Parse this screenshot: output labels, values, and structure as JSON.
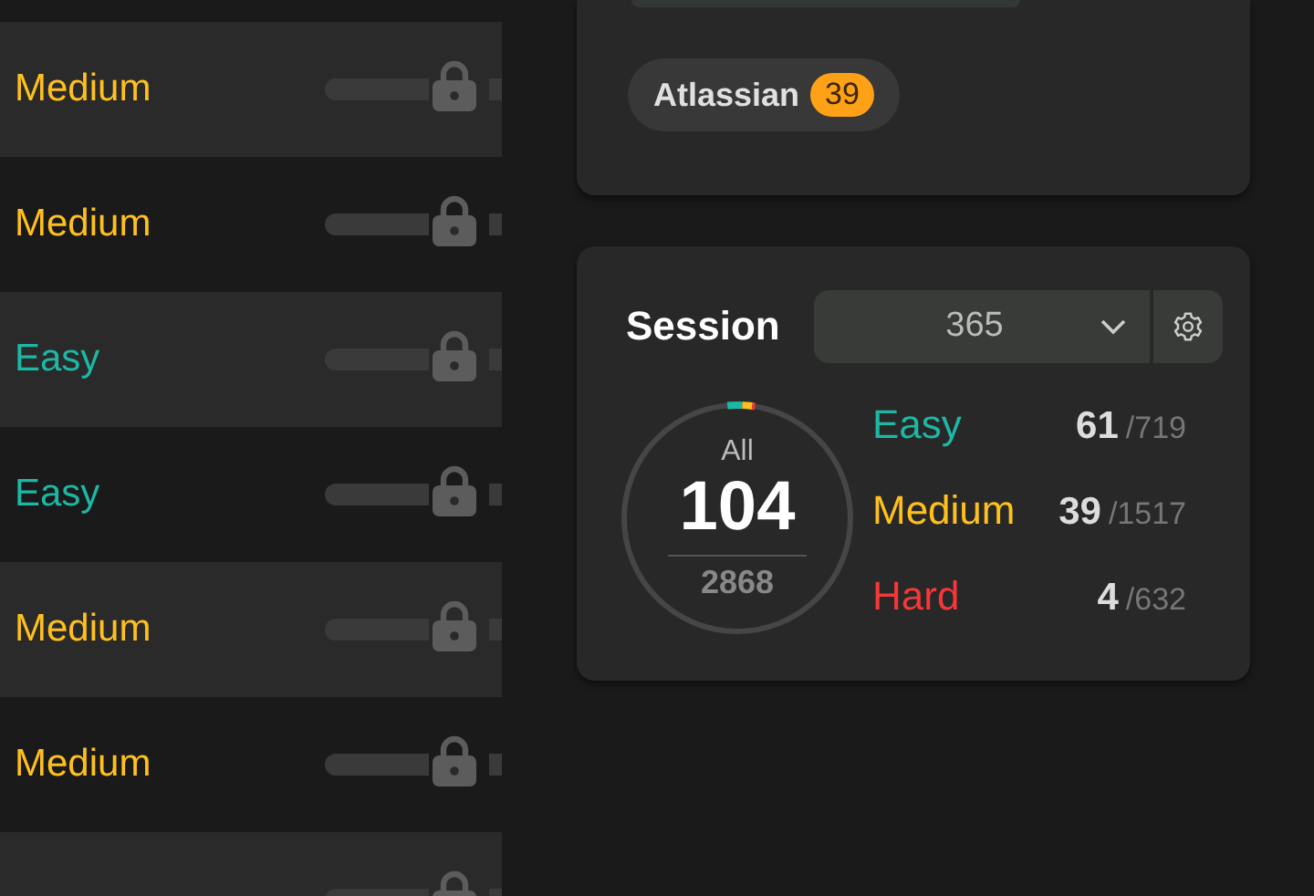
{
  "questions": [
    {
      "difficulty": "Medium",
      "color": "#ffc01e"
    },
    {
      "difficulty": "Medium",
      "color": "#ffc01e"
    },
    {
      "difficulty": "Easy",
      "color": "#1cb8a5"
    },
    {
      "difficulty": "Easy",
      "color": "#1cb8a5"
    },
    {
      "difficulty": "Medium",
      "color": "#ffc01e"
    },
    {
      "difficulty": "Medium",
      "color": "#ffc01e"
    }
  ],
  "companies": {
    "tags": [
      {
        "name": "Atlassian",
        "count": "39"
      }
    ]
  },
  "session": {
    "label": "Session",
    "dropdown": "365",
    "ring": {
      "label": "All",
      "solved": "104",
      "total": "2868"
    },
    "stats": [
      {
        "label": "Easy",
        "color": "#1cb8a5",
        "solved": "61",
        "total": "/719",
        "level": 0.021
      },
      {
        "label": "Medium",
        "color": "#ffc01e",
        "solved": "39",
        "total": "/1517",
        "level": 0.014
      },
      {
        "label": "Hard",
        "color": "#f63737",
        "solved": "4",
        "total": "/632",
        "level": 0.0014
      }
    ]
  }
}
